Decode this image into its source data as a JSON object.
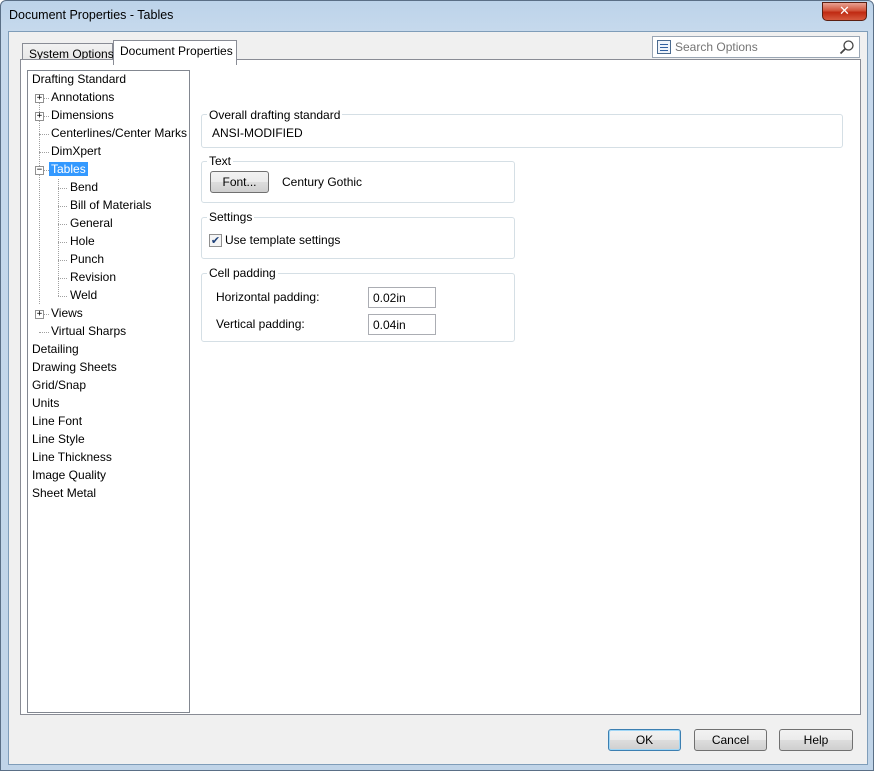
{
  "window": {
    "title": "Document Properties - Tables",
    "close_glyph": "✕"
  },
  "tabs": [
    {
      "label": "System Options"
    },
    {
      "label": "Document Properties"
    }
  ],
  "search": {
    "placeholder": "Search Options"
  },
  "tree": {
    "items": [
      {
        "label": "Drafting Standard"
      },
      {
        "label": "Annotations",
        "expander": "+"
      },
      {
        "label": "Dimensions",
        "expander": "+"
      },
      {
        "label": "Centerlines/Center Marks"
      },
      {
        "label": "DimXpert"
      },
      {
        "label": "Tables",
        "expander": "−",
        "selected": true
      },
      {
        "label": "Bend"
      },
      {
        "label": "Bill of Materials"
      },
      {
        "label": "General"
      },
      {
        "label": "Hole"
      },
      {
        "label": "Punch"
      },
      {
        "label": "Revision"
      },
      {
        "label": "Weld"
      },
      {
        "label": "Views",
        "expander": "+"
      },
      {
        "label": "Virtual Sharps"
      },
      {
        "label": "Detailing"
      },
      {
        "label": "Drawing Sheets"
      },
      {
        "label": "Grid/Snap"
      },
      {
        "label": "Units"
      },
      {
        "label": "Line Font"
      },
      {
        "label": "Line Style"
      },
      {
        "label": "Line Thickness"
      },
      {
        "label": "Image Quality"
      },
      {
        "label": "Sheet Metal"
      }
    ]
  },
  "overall": {
    "label": "Overall drafting standard",
    "value": "ANSI-MODIFIED"
  },
  "text_group": {
    "label": "Text",
    "font_button": "Font...",
    "font_name": "Century Gothic"
  },
  "settings": {
    "label": "Settings",
    "use_template": "Use template settings",
    "checked_glyph": "✔"
  },
  "cell_padding": {
    "label": "Cell padding",
    "horizontal_label": "Horizontal padding:",
    "horizontal_value": "0.02in",
    "vertical_label": "Vertical padding:",
    "vertical_value": "0.04in"
  },
  "footer": {
    "ok": "OK",
    "cancel": "Cancel",
    "help": "Help"
  },
  "colors": {
    "selection": "#3399ff",
    "close_button": "#c7321a"
  }
}
